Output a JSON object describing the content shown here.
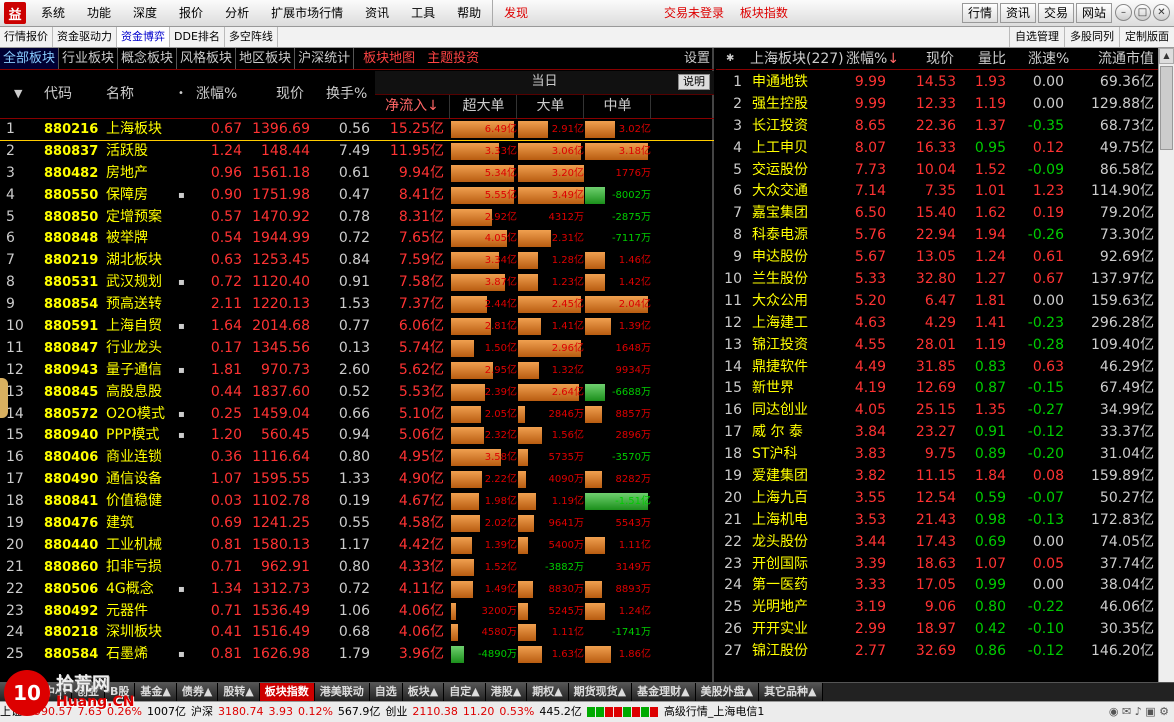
{
  "menubar": {
    "logo": "益",
    "items": [
      "系统",
      "功能",
      "深度",
      "报价",
      "分析",
      "扩展市场行情",
      "资讯",
      "工具",
      "帮助"
    ],
    "discover": "发现",
    "notice": [
      "交易未登录",
      "板块指数"
    ],
    "buttons": [
      "行情",
      "资讯",
      "交易",
      "网站"
    ]
  },
  "subtabs": {
    "items": [
      "行情报价",
      "资金驱动力",
      "资金博弈",
      "DDE排名",
      "多空阵线"
    ],
    "active": 2,
    "right": [
      "自选管理",
      "多股同列",
      "定制版面"
    ]
  },
  "left": {
    "cat_tabs": [
      "全部板块",
      "行业板块",
      "概念板块",
      "风格板块",
      "地区板块",
      "沪深统计"
    ],
    "red_tabs": [
      "板块地图",
      "主题投资"
    ],
    "settings": "设置",
    "day_label": "当日",
    "explain": "说明",
    "headers": {
      "code": "代码",
      "name": "名称",
      "chg": "涨幅%",
      "price": "现价",
      "turnover": "换手%",
      "inflow": "净流入",
      "super": "超大单",
      "large": "大单",
      "mid": "中单"
    },
    "rows": [
      {
        "i": "1",
        "code": "880216",
        "name": "上海板块",
        "dot": "",
        "chg": "0.67",
        "price": "1396.69",
        "turn": "0.56",
        "inflow": "15.25亿",
        "s": "6.49亿",
        "sv": 0.95,
        "l": "2.91亿",
        "lv": 0.45,
        "m": "3.02亿",
        "mv": 0.46
      },
      {
        "i": "2",
        "code": "880837",
        "name": "活跃股",
        "dot": "",
        "chg": "1.24",
        "price": "148.44",
        "turn": "7.49",
        "inflow": "11.95亿",
        "s": "3.33亿",
        "sv": 0.72,
        "l": "3.06亿",
        "lv": 0.95,
        "m": "3.18亿",
        "mv": 0.95
      },
      {
        "i": "3",
        "code": "880482",
        "name": "房地产",
        "dot": "",
        "chg": "0.96",
        "price": "1561.18",
        "turn": "0.61",
        "inflow": "9.94亿",
        "s": "5.34亿",
        "sv": 0.95,
        "l": "3.20亿",
        "lv": 1.0,
        "m": "1776万",
        "mv": 0.0
      },
      {
        "i": "4",
        "code": "880550",
        "name": "保障房",
        "dot": "▪",
        "chg": "0.90",
        "price": "1751.98",
        "turn": "0.47",
        "inflow": "8.41亿",
        "s": "5.55亿",
        "sv": 0.95,
        "l": "3.49亿",
        "lv": 1.0,
        "m": "-8002万",
        "mv": -0.3
      },
      {
        "i": "5",
        "code": "880850",
        "name": "定增预案",
        "dot": "",
        "chg": "0.57",
        "price": "1470.92",
        "turn": "0.78",
        "inflow": "8.31亿",
        "s": "2.92亿",
        "sv": 0.62,
        "l": "4312万",
        "lv": 0.0,
        "m": "-2875万",
        "mv": 0.0
      },
      {
        "i": "6",
        "code": "880848",
        "name": "被举牌",
        "dot": "",
        "chg": "0.54",
        "price": "1944.99",
        "turn": "0.72",
        "inflow": "7.65亿",
        "s": "4.05亿",
        "sv": 0.85,
        "l": "2.31亿",
        "lv": 0.5,
        "m": "-7117万",
        "mv": 0.0
      },
      {
        "i": "7",
        "code": "880219",
        "name": "湖北板块",
        "dot": "",
        "chg": "0.63",
        "price": "1253.45",
        "turn": "0.84",
        "inflow": "7.59亿",
        "s": "3.34亿",
        "sv": 0.72,
        "l": "1.28亿",
        "lv": 0.3,
        "m": "1.46亿",
        "mv": 0.3
      },
      {
        "i": "8",
        "code": "880531",
        "name": "武汉规划",
        "dot": "▪",
        "chg": "0.72",
        "price": "1120.40",
        "turn": "0.91",
        "inflow": "7.58亿",
        "s": "3.87亿",
        "sv": 0.82,
        "l": "1.23亿",
        "lv": 0.3,
        "m": "1.42亿",
        "mv": 0.3
      },
      {
        "i": "9",
        "code": "880854",
        "name": "预高送转",
        "dot": "",
        "chg": "2.11",
        "price": "1220.13",
        "turn": "1.53",
        "inflow": "7.37亿",
        "s": "2.44亿",
        "sv": 0.54,
        "l": "2.45亿",
        "lv": 0.95,
        "m": "2.04亿",
        "mv": 0.95
      },
      {
        "i": "10",
        "code": "880591",
        "name": "上海自贸",
        "dot": "▪",
        "chg": "1.64",
        "price": "2014.68",
        "turn": "0.77",
        "inflow": "6.06亿",
        "s": "2.81亿",
        "sv": 0.6,
        "l": "1.41亿",
        "lv": 0.35,
        "m": "1.39亿",
        "mv": 0.4
      },
      {
        "i": "11",
        "code": "880847",
        "name": "行业龙头",
        "dot": "",
        "chg": "0.17",
        "price": "1345.56",
        "turn": "0.13",
        "inflow": "5.74亿",
        "s": "1.50亿",
        "sv": 0.35,
        "l": "2.96亿",
        "lv": 0.95,
        "m": "1648万",
        "mv": 0.0
      },
      {
        "i": "12",
        "code": "880943",
        "name": "量子通信",
        "dot": "▪",
        "chg": "1.81",
        "price": "970.73",
        "turn": "2.60",
        "inflow": "5.62亿",
        "s": "2.95亿",
        "sv": 0.63,
        "l": "1.32亿",
        "lv": 0.32,
        "m": "9934万",
        "mv": 0.0
      },
      {
        "i": "13",
        "code": "880845",
        "name": "高股息股",
        "dot": "",
        "chg": "0.44",
        "price": "1837.60",
        "turn": "0.52",
        "inflow": "5.53亿",
        "s": "2.39亿",
        "sv": 0.52,
        "l": "2.64亿",
        "lv": 0.93,
        "m": "-6688万",
        "mv": -0.3
      },
      {
        "i": "14",
        "code": "880572",
        "name": "O2O模式",
        "dot": "▪",
        "chg": "0.25",
        "price": "1459.04",
        "turn": "0.66",
        "inflow": "5.10亿",
        "s": "2.05亿",
        "sv": 0.45,
        "l": "2846万",
        "lv": 0.1,
        "m": "8857万",
        "mv": 0.25
      },
      {
        "i": "15",
        "code": "880940",
        "name": "PPP模式",
        "dot": "▪",
        "chg": "1.20",
        "price": "560.45",
        "turn": "0.94",
        "inflow": "5.06亿",
        "s": "2.32亿",
        "sv": 0.5,
        "l": "1.56亿",
        "lv": 0.36,
        "m": "2896万",
        "mv": 0.0
      },
      {
        "i": "16",
        "code": "880406",
        "name": "商业连锁",
        "dot": "",
        "chg": "0.36",
        "price": "1116.64",
        "turn": "0.80",
        "inflow": "4.95亿",
        "s": "3.58亿",
        "sv": 0.75,
        "l": "5735万",
        "lv": 0.15,
        "m": "-3570万",
        "mv": 0.0
      },
      {
        "i": "17",
        "code": "880490",
        "name": "通信设备",
        "dot": "",
        "chg": "1.07",
        "price": "1595.55",
        "turn": "1.33",
        "inflow": "4.90亿",
        "s": "2.22亿",
        "sv": 0.47,
        "l": "4090万",
        "lv": 0.12,
        "m": "8282万",
        "mv": 0.25
      },
      {
        "i": "18",
        "code": "880841",
        "name": "价值稳健",
        "dot": "",
        "chg": "0.03",
        "price": "1102.78",
        "turn": "0.19",
        "inflow": "4.67亿",
        "s": "1.98亿",
        "sv": 0.43,
        "l": "1.19亿",
        "lv": 0.28,
        "m": "-1.51亿",
        "mv": -0.95
      },
      {
        "i": "19",
        "code": "880476",
        "name": "建筑",
        "dot": "",
        "chg": "0.69",
        "price": "1241.25",
        "turn": "0.55",
        "inflow": "4.58亿",
        "s": "2.02亿",
        "sv": 0.44,
        "l": "9641万",
        "lv": 0.24,
        "m": "5543万",
        "mv": 0.0
      },
      {
        "i": "20",
        "code": "880440",
        "name": "工业机械",
        "dot": "",
        "chg": "0.81",
        "price": "1580.13",
        "turn": "1.17",
        "inflow": "4.42亿",
        "s": "1.39亿",
        "sv": 0.32,
        "l": "5400万",
        "lv": 0.15,
        "m": "1.11亿",
        "mv": 0.3
      },
      {
        "i": "21",
        "code": "880860",
        "name": "扣非亏损",
        "dot": "",
        "chg": "0.71",
        "price": "962.91",
        "turn": "0.80",
        "inflow": "4.33亿",
        "s": "1.52亿",
        "sv": 0.35,
        "l": "-3882万",
        "lv": 0.0,
        "m": "3149万",
        "mv": 0.0
      },
      {
        "i": "22",
        "code": "880506",
        "name": "4G概念",
        "dot": "▪",
        "chg": "1.34",
        "price": "1312.73",
        "turn": "0.72",
        "inflow": "4.11亿",
        "s": "1.49亿",
        "sv": 0.34,
        "l": "8830万",
        "lv": 0.22,
        "m": "8893万",
        "mv": 0.25
      },
      {
        "i": "23",
        "code": "880492",
        "name": "元器件",
        "dot": "",
        "chg": "0.71",
        "price": "1536.49",
        "turn": "1.06",
        "inflow": "4.06亿",
        "s": "3200万",
        "sv": 0.08,
        "l": "5245万",
        "lv": 0.15,
        "m": "1.24亿",
        "mv": 0.3
      },
      {
        "i": "24",
        "code": "880218",
        "name": "深圳板块",
        "dot": "",
        "chg": "0.41",
        "price": "1516.49",
        "turn": "0.68",
        "inflow": "4.06亿",
        "s": "4580万",
        "sv": 0.11,
        "l": "1.11亿",
        "lv": 0.28,
        "m": "-1741万",
        "mv": 0.0
      },
      {
        "i": "25",
        "code": "880584",
        "name": "石墨烯",
        "dot": "▪",
        "chg": "0.81",
        "price": "1626.98",
        "turn": "1.79",
        "inflow": "3.96亿",
        "s": "-4890万",
        "sv": -0.2,
        "l": "1.63亿",
        "lv": 0.37,
        "m": "1.86亿",
        "mv": 0.4
      }
    ]
  },
  "right": {
    "header": {
      "title": "上海板块(227)",
      "chg": "涨幅%",
      "price": "现价",
      "vol": "量比",
      "speed": "涨速%",
      "cap": "流通市值"
    },
    "rows": [
      {
        "i": "1",
        "name": "申通地铁",
        "chg": "9.99",
        "price": "14.53",
        "vol": "1.93",
        "spd": "0.00",
        "cap": "69.36亿"
      },
      {
        "i": "2",
        "name": "强生控股",
        "chg": "9.99",
        "price": "12.33",
        "vol": "1.19",
        "spd": "0.00",
        "cap": "129.88亿"
      },
      {
        "i": "3",
        "name": "长江投资",
        "chg": "8.65",
        "price": "22.36",
        "vol": "1.37",
        "spd": "-0.35",
        "cap": "68.73亿"
      },
      {
        "i": "4",
        "name": "上工申贝",
        "chg": "8.07",
        "price": "16.33",
        "vol": "0.95",
        "spd": "0.12",
        "cap": "49.75亿"
      },
      {
        "i": "5",
        "name": "交运股份",
        "chg": "7.73",
        "price": "10.04",
        "vol": "1.52",
        "spd": "-0.09",
        "cap": "86.58亿"
      },
      {
        "i": "6",
        "name": "大众交通",
        "chg": "7.14",
        "price": "7.35",
        "vol": "1.01",
        "spd": "1.23",
        "cap": "114.90亿"
      },
      {
        "i": "7",
        "name": "嘉宝集团",
        "chg": "6.50",
        "price": "15.40",
        "vol": "1.62",
        "spd": "0.19",
        "cap": "79.20亿"
      },
      {
        "i": "8",
        "name": "科泰电源",
        "chg": "5.76",
        "price": "22.94",
        "vol": "1.94",
        "spd": "-0.26",
        "cap": "73.30亿"
      },
      {
        "i": "9",
        "name": "申达股份",
        "chg": "5.67",
        "price": "13.05",
        "vol": "1.24",
        "spd": "0.61",
        "cap": "92.69亿"
      },
      {
        "i": "10",
        "name": "兰生股份",
        "chg": "5.33",
        "price": "32.80",
        "vol": "1.27",
        "spd": "0.67",
        "cap": "137.97亿"
      },
      {
        "i": "11",
        "name": "大众公用",
        "chg": "5.20",
        "price": "6.47",
        "vol": "1.81",
        "spd": "0.00",
        "cap": "159.63亿"
      },
      {
        "i": "12",
        "name": "上海建工",
        "chg": "4.63",
        "price": "4.29",
        "vol": "1.41",
        "spd": "-0.23",
        "cap": "296.28亿"
      },
      {
        "i": "13",
        "name": "锦江投资",
        "chg": "4.55",
        "price": "28.01",
        "vol": "1.19",
        "spd": "-0.28",
        "cap": "109.40亿"
      },
      {
        "i": "14",
        "name": "鼎捷软件",
        "chg": "4.49",
        "price": "31.85",
        "vol": "0.83",
        "spd": "0.63",
        "cap": "46.29亿"
      },
      {
        "i": "15",
        "name": "新世界",
        "chg": "4.19",
        "price": "12.69",
        "vol": "0.87",
        "spd": "-0.15",
        "cap": "67.49亿"
      },
      {
        "i": "16",
        "name": "同达创业",
        "chg": "4.05",
        "price": "25.15",
        "vol": "1.35",
        "spd": "-0.27",
        "cap": "34.99亿"
      },
      {
        "i": "17",
        "name": "威 尔 泰",
        "chg": "3.84",
        "price": "23.27",
        "vol": "0.91",
        "spd": "-0.12",
        "cap": "33.37亿"
      },
      {
        "i": "18",
        "name": "ST沪科",
        "chg": "3.83",
        "price": "9.75",
        "vol": "0.89",
        "spd": "-0.20",
        "cap": "31.04亿"
      },
      {
        "i": "19",
        "name": "爱建集团",
        "chg": "3.82",
        "price": "11.15",
        "vol": "1.84",
        "spd": "0.08",
        "cap": "159.89亿"
      },
      {
        "i": "20",
        "name": "上海九百",
        "chg": "3.55",
        "price": "12.54",
        "vol": "0.59",
        "spd": "-0.07",
        "cap": "50.27亿"
      },
      {
        "i": "21",
        "name": "上海机电",
        "chg": "3.53",
        "price": "21.43",
        "vol": "0.98",
        "spd": "-0.13",
        "cap": "172.83亿"
      },
      {
        "i": "22",
        "name": "龙头股份",
        "chg": "3.44",
        "price": "17.43",
        "vol": "0.69",
        "spd": "0.00",
        "cap": "74.05亿"
      },
      {
        "i": "23",
        "name": "开创国际",
        "chg": "3.39",
        "price": "18.63",
        "vol": "1.07",
        "spd": "0.05",
        "cap": "37.74亿"
      },
      {
        "i": "24",
        "name": "第一医药",
        "chg": "3.33",
        "price": "17.05",
        "vol": "0.99",
        "spd": "0.00",
        "cap": "38.04亿"
      },
      {
        "i": "25",
        "name": "光明地产",
        "chg": "3.19",
        "price": "9.06",
        "vol": "0.80",
        "spd": "-0.22",
        "cap": "46.06亿"
      },
      {
        "i": "26",
        "name": "开开实业",
        "chg": "2.99",
        "price": "18.97",
        "vol": "0.42",
        "spd": "-0.10",
        "cap": "30.35亿"
      },
      {
        "i": "27",
        "name": "锦江股份",
        "chg": "2.77",
        "price": "32.69",
        "vol": "0.86",
        "spd": "-0.12",
        "cap": "146.20亿"
      }
    ]
  },
  "bottom_tabs": [
    "A股▲",
    "中小",
    "创业",
    "B股",
    "基金▲",
    "债券▲",
    "股转▲",
    "板块指数",
    "港美联动",
    "自选",
    "板块▲",
    "自定▲",
    "港股▲",
    "期权▲",
    "期货现货▲",
    "基金理财▲",
    "美股外盘▲",
    "其它品种▲"
  ],
  "bottom_active": 7,
  "status": {
    "sh_label": "上证",
    "sh_val": "2990.57",
    "sh_chg": "7.63",
    "sh_pct": "0.26%",
    "sh_amt": "1007亿",
    "hs_label": "沪深",
    "hs_val": "3180.74",
    "hs_chg": "3.93",
    "hs_pct": "0.12%",
    "hs_amt": "567.9亿",
    "cy_label": "创业",
    "cy_val": "2110.38",
    "cy_chg": "11.20",
    "cy_pct": "0.53%",
    "cy_amt": "445.2亿",
    "feed": "高级行情_上海电信1"
  },
  "watermark": {
    "num": "10",
    "top": "拾荒网",
    "bottom": "Huang.CN"
  }
}
